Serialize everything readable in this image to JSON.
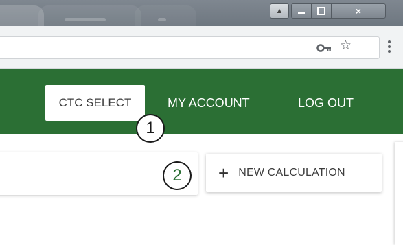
{
  "nav": {
    "items": [
      {
        "label": "CTC SELECT",
        "active": true
      },
      {
        "label": "MY ACCOUNT"
      },
      {
        "label": "LOG OUT"
      }
    ]
  },
  "content": {
    "new_calculation_label": "NEW CALCULATION"
  },
  "callouts": [
    {
      "number": "1"
    },
    {
      "number": "2"
    }
  ],
  "icons": {
    "profile": "profile-icon",
    "minimize": "minimize-icon",
    "maximize": "maximize-icon",
    "close": "close-icon",
    "key": "key-icon",
    "star": "star-icon",
    "menu": "kebab-menu-icon",
    "plus": "plus-icon"
  },
  "colors": {
    "nav_background": "#2b6f34",
    "titlebar": "#7f8790",
    "callout_2_text": "#2b6f34"
  }
}
